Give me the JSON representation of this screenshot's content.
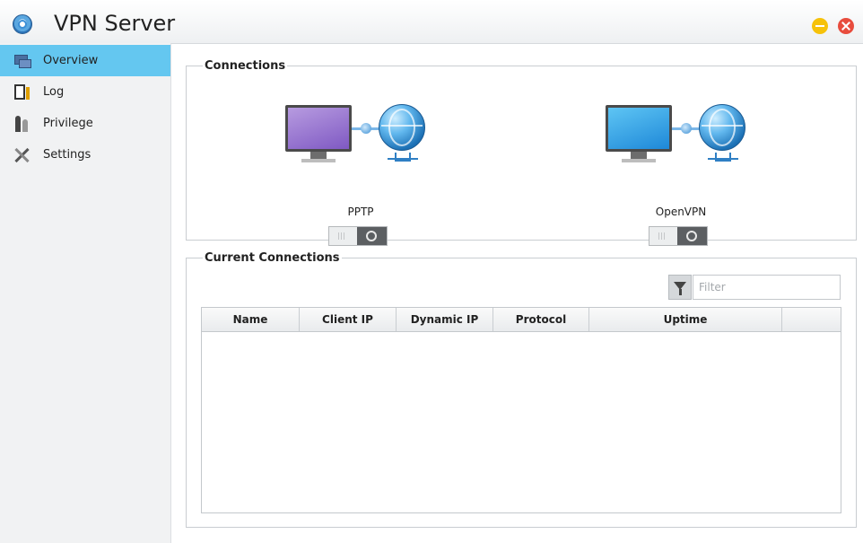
{
  "window": {
    "title": "VPN Server"
  },
  "sidebar": {
    "items": [
      {
        "label": "Overview",
        "icon": "overview-icon",
        "active": true
      },
      {
        "label": "Log",
        "icon": "log-icon"
      },
      {
        "label": "Privilege",
        "icon": "privilege-icon"
      },
      {
        "label": "Settings",
        "icon": "settings-icon"
      }
    ]
  },
  "connections": {
    "legend": "Connections",
    "protocols": [
      {
        "label": "PPTP",
        "enabled": false,
        "monitor_color": "#8f6bd0"
      },
      {
        "label": "OpenVPN",
        "enabled": false,
        "monitor_color": "#2a9be6"
      }
    ]
  },
  "current": {
    "legend": "Current Connections",
    "filter": {
      "placeholder": "Filter",
      "value": ""
    },
    "columns": [
      "Name",
      "Client IP",
      "Dynamic IP",
      "Protocol",
      "Uptime",
      ""
    ],
    "rows": []
  },
  "colors": {
    "accent": "#64c7f0",
    "minimize": "#f6c20a",
    "close": "#e84c3d"
  }
}
